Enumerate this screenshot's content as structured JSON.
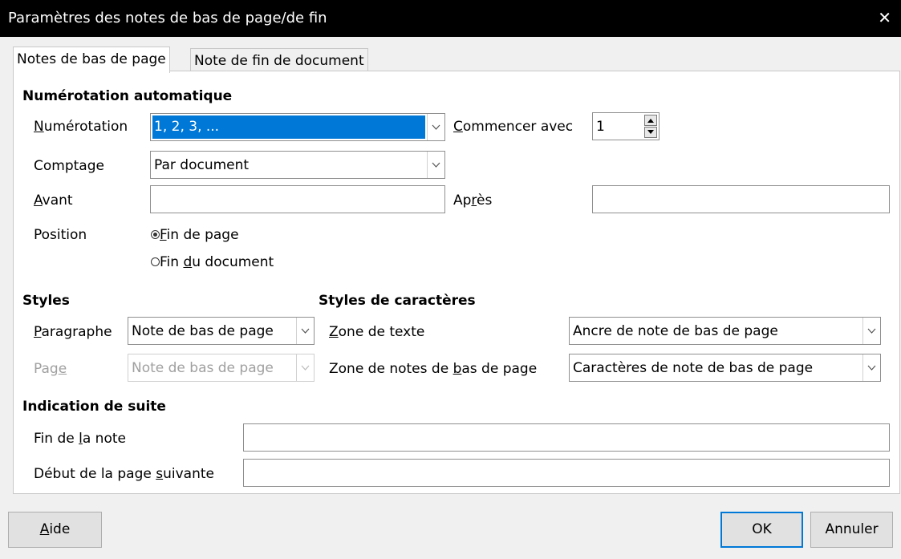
{
  "window": {
    "title": "Paramètres des notes de bas de page/de fin",
    "close_glyph": "✕"
  },
  "tabs": [
    {
      "label": "Notes de bas de page"
    },
    {
      "label": "Note de fin de document"
    }
  ],
  "auto_numbering": {
    "header": "Numérotation automatique",
    "numbering": {
      "label_pre": "",
      "label_u": "N",
      "label_post": "umérotation",
      "value": "1, 2, 3, ..."
    },
    "start_with": {
      "label_pre": "",
      "label_u": "C",
      "label_post": "ommencer avec",
      "value": "1"
    },
    "counting": {
      "label": "Comptage",
      "value": "Par document"
    },
    "before": {
      "label_pre": "",
      "label_u": "A",
      "label_post": "vant",
      "value": ""
    },
    "after": {
      "label_pre": "Ap",
      "label_u": "r",
      "label_post": "ès",
      "value": ""
    },
    "position": {
      "label": "Position",
      "options": [
        {
          "pre": "",
          "u": "F",
          "post": "in de page",
          "selected": true
        },
        {
          "pre": "Fin ",
          "u": "d",
          "post": "u document",
          "selected": false
        }
      ]
    }
  },
  "styles": {
    "header": "Styles",
    "paragraph": {
      "label_pre": "",
      "label_u": "P",
      "label_post": "aragraphe",
      "value": "Note de bas de page"
    },
    "page": {
      "label_pre": "Pag",
      "label_u": "e",
      "label_post": "",
      "value": "Note de bas de page",
      "disabled": true
    }
  },
  "char_styles": {
    "header": "Styles de caractères",
    "text_area": {
      "label_pre": "",
      "label_u": "Z",
      "label_post": "one de texte",
      "value": "Ancre de note de bas de page"
    },
    "footnote_area": {
      "label_pre": "Zone de notes de ",
      "label_u": "b",
      "label_post": "as de page",
      "value": "Caractères de note de bas de page"
    }
  },
  "continuation": {
    "header": "Indication de suite",
    "end_of_note": {
      "label_pre": "Fin de ",
      "label_u": "l",
      "label_post": "a note",
      "value": ""
    },
    "start_next_page": {
      "label_pre": "Début de la page ",
      "label_u": "s",
      "label_post": "uivante",
      "value": ""
    }
  },
  "buttons": {
    "help": {
      "pre": "",
      "u": "A",
      "post": "ide"
    },
    "ok": "OK",
    "cancel": "Annuler"
  },
  "colors": {
    "titlebar": "#000000",
    "selection": "#0078d7",
    "dialog_bg": "#f0f0f0"
  }
}
